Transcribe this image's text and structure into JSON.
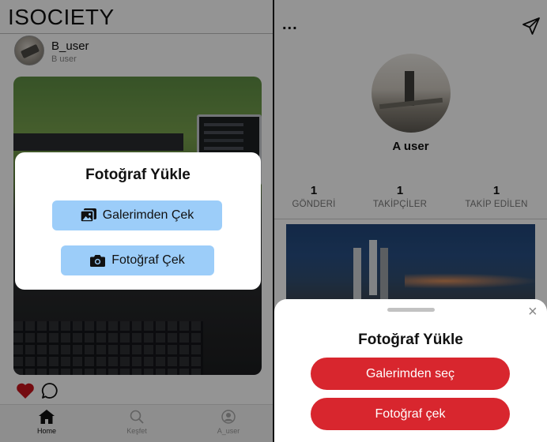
{
  "left_screen": {
    "app_title": "ISOCIETY",
    "post": {
      "user_name": "B_user",
      "user_handle": "B user"
    },
    "tabs": [
      {
        "label": "Home",
        "icon": "home-icon",
        "active": true
      },
      {
        "label": "Keşfet",
        "icon": "search-icon",
        "active": false
      },
      {
        "label": "A_user",
        "icon": "profile-icon",
        "active": false
      }
    ],
    "upload_modal": {
      "title": "Fotoğraf Yükle",
      "gallery_button": "Galerimden Çek",
      "camera_button": "Fotoğraf Çek"
    }
  },
  "right_screen": {
    "more_label": "...",
    "profile": {
      "name": "A user",
      "stats": [
        {
          "count": "1",
          "label": "GÖNDERİ"
        },
        {
          "count": "1",
          "label": "TAKİPÇİLER"
        },
        {
          "count": "1",
          "label": "TAKİP EDİLEN"
        }
      ]
    },
    "upload_sheet": {
      "title": "Fotoğraf Yükle",
      "gallery_button": "Galerimden seç",
      "camera_button": "Fotoğraf çek",
      "close_label": "×"
    }
  },
  "colors": {
    "modal_button_blue": "#9ccdf9",
    "sheet_button_red": "#d8262e",
    "like_heart_red": "#c8141c"
  }
}
